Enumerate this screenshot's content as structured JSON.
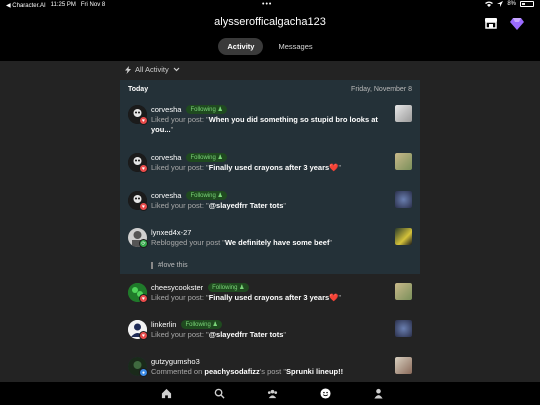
{
  "status": {
    "back_app": "◀ Character.AI",
    "time": "11:25 PM",
    "date": "Fri Nov 8",
    "battery": "8%"
  },
  "header": {
    "title": "alysserofficalgacha123",
    "tabs": [
      {
        "label": "Activity",
        "active": true
      },
      {
        "label": "Messages",
        "active": false
      }
    ]
  },
  "filter": {
    "label": "All Activity"
  },
  "today": {
    "label": "Today",
    "date": "Friday, November 8"
  },
  "items": [
    {
      "name": "corvesha",
      "following": "Following",
      "action": "Liked your post: \"",
      "post": "When you did something so stupid bro looks at you...",
      "end": "\"",
      "badge": "like"
    },
    {
      "name": "corvesha",
      "following": "Following",
      "action": "Liked your post: \"",
      "post": "Finally used crayons after 3 years❤️",
      "end": "\"",
      "badge": "like"
    },
    {
      "name": "corvesha",
      "following": "Following",
      "action": "Liked your post: \"",
      "post": "@slayedfrr  Tater tots",
      "end": "\"",
      "badge": "like"
    },
    {
      "name": "lynxed4x-27",
      "following": "",
      "action": "Reblogged your post \"",
      "post": "We definitely have some beef",
      "end": "\"",
      "quote": "#love this",
      "badge": "reblog"
    },
    {
      "name": "cheesycookster",
      "following": "Following",
      "action": "Liked your post: \"",
      "post": "Finally used crayons after 3 years❤️",
      "end": "\"",
      "badge": "like"
    },
    {
      "name": "linkerlin",
      "following": "Following",
      "action": "Liked your post: \"",
      "post": "@slayedfrr  Tater tots",
      "end": "\"",
      "badge": "like"
    },
    {
      "name": "gutzygumsho3",
      "following": "",
      "action": "Commented on ",
      "actor2": "peachysodafizz",
      "action2": "'s post \"",
      "post": "Sprunki lineup!!",
      "end": "",
      "badge": "comment"
    }
  ],
  "nav": [
    "home-icon",
    "search-icon",
    "community-icon",
    "activity-icon",
    "profile-icon"
  ],
  "colors": {
    "today_bg": "#243138",
    "following": "#7cd67a",
    "like": "#e94b4b",
    "reblog": "#34a84a",
    "comment": "#3b8ae6"
  }
}
